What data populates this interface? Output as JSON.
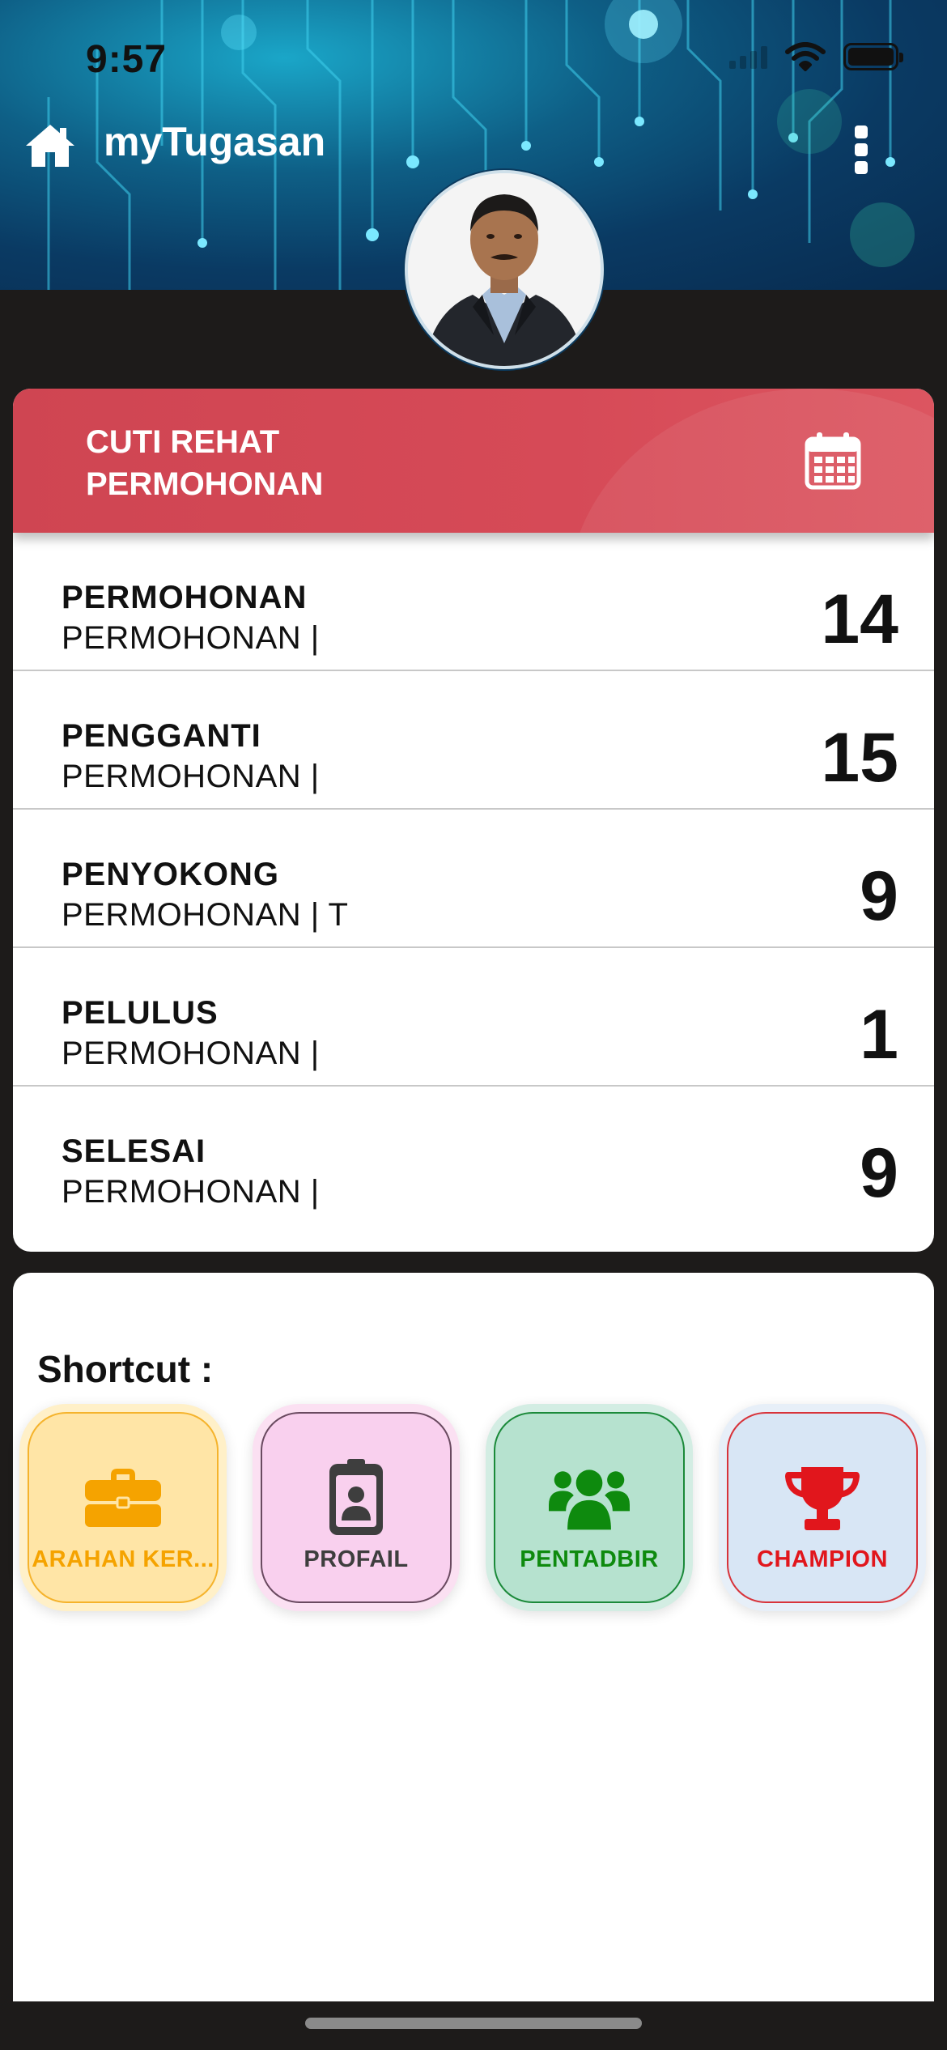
{
  "status_bar": {
    "time": "9:57"
  },
  "app_bar": {
    "title": "myTugasan"
  },
  "leave_card": {
    "title": "CUTI REHAT PERMOHONAN",
    "rows": [
      {
        "label": "PERMOHONAN",
        "sub": "PERMOHONAN |",
        "count": "14"
      },
      {
        "label": "PENGGANTI",
        "sub": "PERMOHONAN |",
        "count": "15"
      },
      {
        "label": "PENYOKONG",
        "sub": "PERMOHONAN | T",
        "count": "9"
      },
      {
        "label": "PELULUS",
        "sub": "PERMOHONAN |",
        "count": "1"
      },
      {
        "label": "SELESAI",
        "sub": "PERMOHONAN |",
        "count": "9"
      }
    ]
  },
  "shortcuts": {
    "title": "Shortcut :",
    "items": [
      {
        "label": "ARAHAN KER...",
        "icon": "briefcase-icon",
        "color": "#f5a300"
      },
      {
        "label": "PROFAIL",
        "icon": "id-badge-icon",
        "color": "#3e3e3e"
      },
      {
        "label": "PENTADBIR",
        "icon": "users-icon",
        "color": "#0e8a0e"
      },
      {
        "label": "CHAMPION",
        "icon": "trophy-icon",
        "color": "#e1161c"
      }
    ]
  },
  "colors": {
    "card_header": "#d64a57",
    "background": "#1d1b1a",
    "banner": "#0a3a63"
  }
}
